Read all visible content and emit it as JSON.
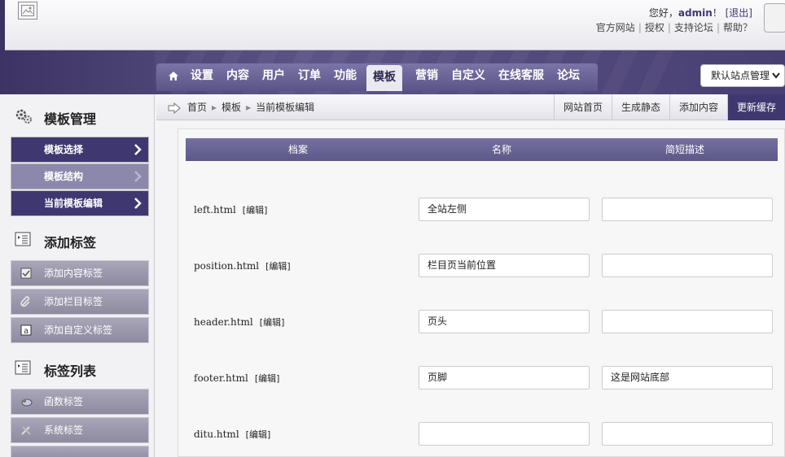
{
  "header": {
    "greeting_prefix": "您好，",
    "username": "admin",
    "greeting_suffix": "！",
    "logout": "[退出]",
    "links": [
      "官方网站",
      "授权",
      "支持论坛",
      "帮助？"
    ]
  },
  "nav": {
    "tabs": [
      "设置",
      "内容",
      "用户",
      "订单",
      "功能",
      "模板",
      "营销",
      "自定义",
      "在线客服",
      "论坛"
    ],
    "active": "模板",
    "site_select": "默认站点管理"
  },
  "sidebar": {
    "sections": [
      {
        "title": "模板管理",
        "icon": "gears-icon"
      },
      {
        "title": "添加标签",
        "icon": "list-icon"
      },
      {
        "title": "标签列表",
        "icon": "list-icon"
      }
    ],
    "template_items": [
      "模板选择",
      "模板结构",
      "当前模板编辑"
    ],
    "add_tag_items": [
      "添加内容标签",
      "添加栏目标签",
      "添加自定义标签"
    ],
    "tag_list_items": [
      "函数标签",
      "系统标签"
    ]
  },
  "breadcrumb": {
    "items": [
      "首页",
      "模板",
      "当前模板编辑"
    ]
  },
  "actions": [
    "网站首页",
    "生成静态",
    "添加内容",
    "更新缓存"
  ],
  "table": {
    "headers": [
      "档案",
      "名称",
      "简短描述"
    ],
    "edit_label": "[编辑]",
    "rows": [
      {
        "file": "left.html",
        "name": "全站左侧",
        "desc": ""
      },
      {
        "file": "position.html",
        "name": "栏目页当前位置",
        "desc": ""
      },
      {
        "file": "header.html",
        "name": "页头",
        "desc": ""
      },
      {
        "file": "footer.html",
        "name": "页脚",
        "desc": "这是网站底部"
      },
      {
        "file": "ditu.html",
        "name": "",
        "desc": ""
      }
    ]
  },
  "colors": {
    "primary": "#3f3870",
    "nav_band": "#4a4275",
    "sidebar_light": "#8c88ab"
  }
}
